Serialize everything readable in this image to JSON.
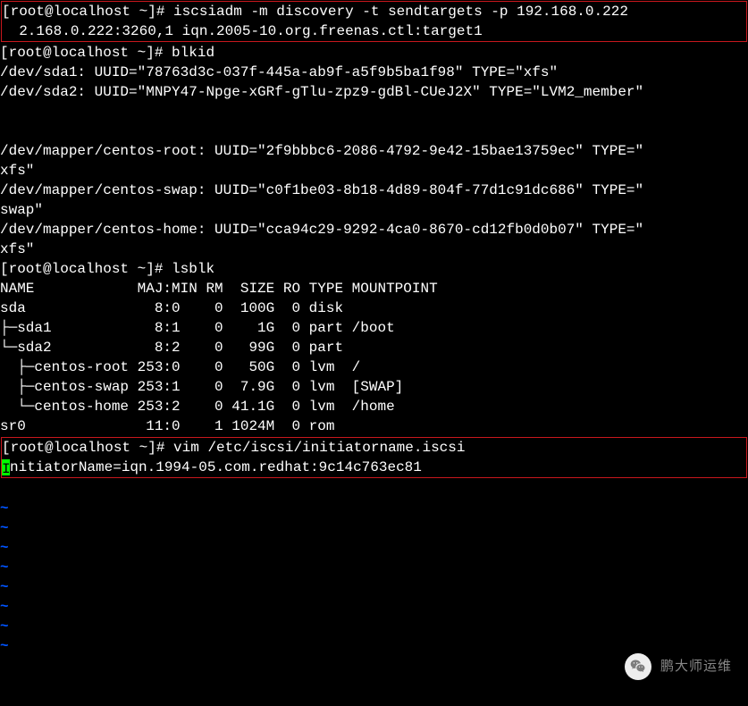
{
  "prompt": "[root@localhost ~]# ",
  "cmd_discovery": "iscsiadm -m discovery -t sendtargets -p 192.168.0.222",
  "discovery_output": "  2.168.0.222:3260,1 iqn.2005-10.org.freenas.ctl:target1",
  "cmd_blkid": "blkid",
  "blkid_lines": [
    "/dev/sda1: UUID=\"78763d3c-037f-445a-ab9f-a5f9b5ba1f98\" TYPE=\"xfs\"",
    "/dev/sda2: UUID=\"MNPY47-Npge-xGRf-gTlu-zpz9-gdBl-CUeJ2X\" TYPE=\"LVM2_member\"",
    "",
    "",
    "/dev/mapper/centos-root: UUID=\"2f9bbbc6-2086-4792-9e42-15bae13759ec\" TYPE=\"",
    "xfs\"",
    "/dev/mapper/centos-swap: UUID=\"c0f1be03-8b18-4d89-804f-77d1c91dc686\" TYPE=\"",
    "swap\"",
    "/dev/mapper/centos-home: UUID=\"cca94c29-9292-4ca0-8670-cd12fb0d0b07\" TYPE=\"",
    "xfs\""
  ],
  "cmd_lsblk": "lsblk",
  "lsblk_header": "NAME            MAJ:MIN RM  SIZE RO TYPE MOUNTPOINT",
  "lsblk_rows": [
    "sda               8:0    0  100G  0 disk ",
    "├─sda1            8:1    0    1G  0 part /boot",
    "└─sda2            8:2    0   99G  0 part ",
    "  ├─centos-root 253:0    0   50G  0 lvm  /",
    "  ├─centos-swap 253:1    0  7.9G  0 lvm  [SWAP]",
    "  └─centos-home 253:2    0 41.1G  0 lvm  /home",
    "sr0              11:0    1 1024M  0 rom  "
  ],
  "cmd_vim": "vim /etc/iscsi/initiatorname.iscsi",
  "vim_line_after_cursor": "nitiatorName=iqn.1994-05.com.redhat:9c14c763ec81",
  "tilde": "~",
  "watermark_text": "鹏大师运维",
  "chart_data": {
    "type": "table",
    "title": "lsblk",
    "columns": [
      "NAME",
      "MAJ:MIN",
      "RM",
      "SIZE",
      "RO",
      "TYPE",
      "MOUNTPOINT"
    ],
    "rows": [
      [
        "sda",
        "8:0",
        0,
        "100G",
        0,
        "disk",
        ""
      ],
      [
        "sda1",
        "8:1",
        0,
        "1G",
        0,
        "part",
        "/boot"
      ],
      [
        "sda2",
        "8:2",
        0,
        "99G",
        0,
        "part",
        ""
      ],
      [
        "centos-root",
        "253:0",
        0,
        "50G",
        0,
        "lvm",
        "/"
      ],
      [
        "centos-swap",
        "253:1",
        0,
        "7.9G",
        0,
        "lvm",
        "[SWAP]"
      ],
      [
        "centos-home",
        "253:2",
        0,
        "41.1G",
        0,
        "lvm",
        "/home"
      ],
      [
        "sr0",
        "11:0",
        1,
        "1024M",
        0,
        "rom",
        ""
      ]
    ]
  }
}
